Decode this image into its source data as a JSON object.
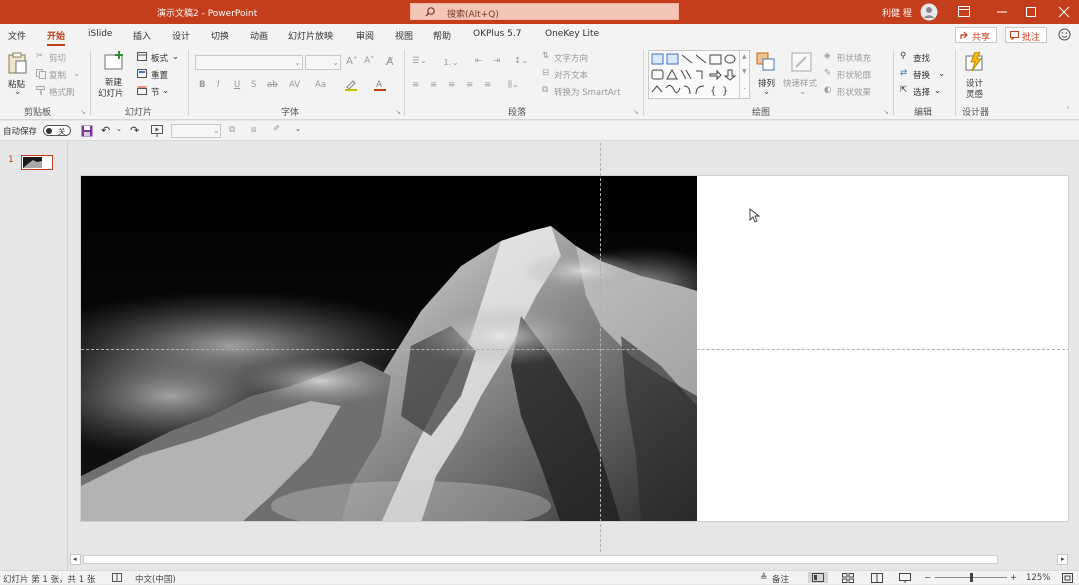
{
  "titlebar": {
    "doc_title": "演示文稿2 - PowerPoint",
    "search_placeholder": "搜索(Alt+Q)",
    "user_name": "利健 程"
  },
  "menu": {
    "tabs": [
      "文件",
      "开始",
      "iSlide",
      "插入",
      "设计",
      "切换",
      "动画",
      "幻灯片放映",
      "审阅",
      "视图",
      "帮助",
      "OKPlus 5.7",
      "OneKey Lite"
    ],
    "active": "开始",
    "share": "共享",
    "comments": "批注"
  },
  "ribbon": {
    "clipboard": {
      "paste": "粘贴",
      "cut": "剪切",
      "copy": "复制",
      "format_painter": "格式刷",
      "label": "剪贴板"
    },
    "slides": {
      "new_slide_1": "新建",
      "new_slide_2": "幻灯片",
      "layout": "板式",
      "reset": "重置",
      "section": "节",
      "label": "幻灯片"
    },
    "font": {
      "bold": "B",
      "italic": "I",
      "underline": "U",
      "strike": "S",
      "label": "字体"
    },
    "paragraph": {
      "text_direction": "文字方向",
      "align_text": "对齐文本",
      "smartart": "转换为 SmartArt",
      "label": "段落"
    },
    "drawing": {
      "arrange": "排列",
      "quick_styles": "快速样式",
      "shape_fill": "形状填充",
      "shape_outline": "形状轮廓",
      "shape_effects": "形状效果",
      "label": "绘图"
    },
    "editing": {
      "find": "查找",
      "replace": "替换",
      "select": "选择",
      "label": "编辑"
    },
    "designer": {
      "design_ideas_1": "设计",
      "design_ideas_2": "灵感",
      "label": "设计器"
    }
  },
  "qat": {
    "autosave": "自动保存",
    "autosave_state": "关"
  },
  "thumbnails": [
    {
      "number": "1"
    }
  ],
  "status": {
    "slide_info": "幻灯片 第 1 张，共 1 张",
    "language": "中文(中国)",
    "notes": "备注",
    "zoom": "125%"
  },
  "colors": {
    "accent": "#c43e1c",
    "ribbon_bg": "#f3f3f3",
    "app_bg": "#e6e6e6"
  }
}
